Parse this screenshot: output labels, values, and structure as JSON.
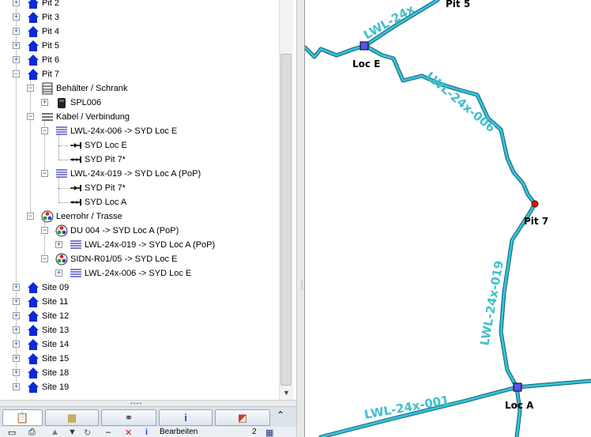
{
  "tree": {
    "nodes": [
      {
        "label": "Pit 2",
        "icon": "house-icon"
      },
      {
        "label": "Pit 3",
        "icon": "house-icon"
      },
      {
        "label": "Pit 4",
        "icon": "house-icon"
      },
      {
        "label": "Pit 5",
        "icon": "house-icon"
      },
      {
        "label": "Pit 6",
        "icon": "house-icon"
      },
      {
        "label": "Pit 7",
        "icon": "house-icon"
      },
      {
        "label": "Behälter / Schrank",
        "icon": "cabinet-group-icon"
      },
      {
        "label": "SPL006",
        "icon": "splice-closure-icon"
      },
      {
        "label": "Kabel / Verbindung",
        "icon": "cable-group-icon"
      },
      {
        "label": "LWL-24x-006 -> SYD Loc E",
        "icon": "fiber-cable-icon"
      },
      {
        "label": "SYD Loc E",
        "icon": "connection-out-icon"
      },
      {
        "label": "SYD Pit 7*",
        "icon": "connection-in-icon"
      },
      {
        "label": "LWL-24x-019 -> SYD Loc A (PoP)",
        "icon": "fiber-cable-icon"
      },
      {
        "label": "SYD Pit 7*",
        "icon": "connection-out-icon"
      },
      {
        "label": "SYD Loc A",
        "icon": "connection-in-icon"
      },
      {
        "label": "Leerrohr / Trasse",
        "icon": "duct-icon"
      },
      {
        "label": "DU 004 -> SYD Loc A (PoP)",
        "icon": "duct-icon"
      },
      {
        "label": "LWL-24x-019 -> SYD Loc A (PoP)",
        "icon": "fiber-cable-icon"
      },
      {
        "label": "SIDN-R01/05 -> SYD Loc E",
        "icon": "duct-icon"
      },
      {
        "label": "LWL-24x-006 -> SYD Loc E",
        "icon": "fiber-cable-icon"
      },
      {
        "label": "Site 09",
        "icon": "house-icon"
      },
      {
        "label": "Site 11",
        "icon": "house-icon"
      },
      {
        "label": "Site 12",
        "icon": "house-icon"
      },
      {
        "label": "Site 13",
        "icon": "house-icon"
      },
      {
        "label": "Site 14",
        "icon": "house-icon"
      },
      {
        "label": "Site 15",
        "icon": "house-icon"
      },
      {
        "label": "Site 18",
        "icon": "house-icon"
      },
      {
        "label": "Site 19",
        "icon": "house-icon"
      }
    ]
  },
  "tabs": [
    {
      "icon": "clipboard-icon",
      "active": true
    },
    {
      "icon": "table-icon",
      "active": false
    },
    {
      "icon": "binoculars-icon",
      "active": false
    },
    {
      "icon": "info-icon",
      "active": false
    },
    {
      "icon": "layers-icon",
      "active": false
    }
  ],
  "toolbar": {
    "edit_label": "Bearbeiten",
    "page_number": "2"
  },
  "map": {
    "line_color": "#2ec4e0",
    "label_color": "#3ec0cc",
    "nodes": {
      "pit5": "Pit 5",
      "loc_e": "Loc E",
      "pit7": "Pit 7",
      "loc_a": "Loc A"
    },
    "cables": {
      "c024": "LWL-24x",
      "c006": "LWL-24x-006",
      "c019": "LWL-24x-019",
      "c001": "LWL-24x-001"
    }
  },
  "colors": {
    "accent": "#0a2ad8",
    "node_square": "#5555ee",
    "pit_marker": "#dd1111"
  }
}
